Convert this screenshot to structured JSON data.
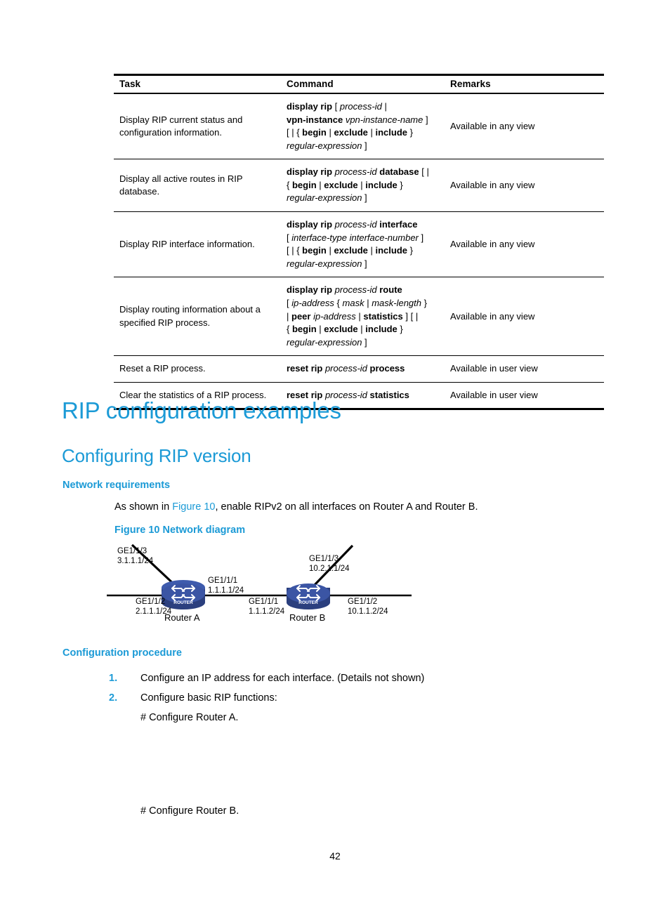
{
  "table": {
    "headers": [
      "Task",
      "Command",
      "Remarks"
    ],
    "rows": [
      {
        "task": "Display RIP current status and configuration information.",
        "command_lines": [
          [
            {
              "t": "display rip",
              "s": "kw"
            },
            {
              "t": " [ ",
              "s": "pn"
            },
            {
              "t": "process-id",
              "s": "var"
            },
            {
              "t": " |",
              "s": "pn"
            }
          ],
          [
            {
              "t": "vpn-instance",
              "s": "kw"
            },
            {
              "t": " ",
              "s": "pn"
            },
            {
              "t": "vpn-instance-name",
              "s": "var"
            },
            {
              "t": " ]",
              "s": "pn"
            }
          ],
          [
            {
              "t": "[ | { ",
              "s": "pn"
            },
            {
              "t": "begin",
              "s": "kw"
            },
            {
              "t": " | ",
              "s": "pn"
            },
            {
              "t": "exclude",
              "s": "kw"
            },
            {
              "t": " | ",
              "s": "pn"
            },
            {
              "t": "include",
              "s": "kw"
            },
            {
              "t": " }",
              "s": "pn"
            }
          ],
          [
            {
              "t": "regular-expression",
              "s": "var"
            },
            {
              "t": " ]",
              "s": "pn"
            }
          ]
        ],
        "remarks": "Available in any view"
      },
      {
        "task": "Display all active routes in RIP database.",
        "command_lines": [
          [
            {
              "t": "display rip",
              "s": "kw"
            },
            {
              "t": " ",
              "s": "pn"
            },
            {
              "t": "process-id",
              "s": "var"
            },
            {
              "t": " ",
              "s": "pn"
            },
            {
              "t": "database",
              "s": "kw"
            },
            {
              "t": " [ |",
              "s": "pn"
            }
          ],
          [
            {
              "t": "{ ",
              "s": "pn"
            },
            {
              "t": "begin",
              "s": "kw"
            },
            {
              "t": " | ",
              "s": "pn"
            },
            {
              "t": "exclude",
              "s": "kw"
            },
            {
              "t": " | ",
              "s": "pn"
            },
            {
              "t": "include",
              "s": "kw"
            },
            {
              "t": " }",
              "s": "pn"
            }
          ],
          [
            {
              "t": "regular-expression",
              "s": "var"
            },
            {
              "t": " ]",
              "s": "pn"
            }
          ]
        ],
        "remarks": "Available in any view"
      },
      {
        "task": "Display RIP interface information.",
        "command_lines": [
          [
            {
              "t": "display rip",
              "s": "kw"
            },
            {
              "t": " ",
              "s": "pn"
            },
            {
              "t": "process-id",
              "s": "var"
            },
            {
              "t": " ",
              "s": "pn"
            },
            {
              "t": "interface",
              "s": "kw"
            }
          ],
          [
            {
              "t": "[ ",
              "s": "pn"
            },
            {
              "t": "interface-type interface-number",
              "s": "var"
            },
            {
              "t": " ]",
              "s": "pn"
            }
          ],
          [
            {
              "t": "[ | { ",
              "s": "pn"
            },
            {
              "t": "begin",
              "s": "kw"
            },
            {
              "t": " | ",
              "s": "pn"
            },
            {
              "t": "exclude",
              "s": "kw"
            },
            {
              "t": " | ",
              "s": "pn"
            },
            {
              "t": "include",
              "s": "kw"
            },
            {
              "t": " }",
              "s": "pn"
            }
          ],
          [
            {
              "t": "regular-expression",
              "s": "var"
            },
            {
              "t": " ]",
              "s": "pn"
            }
          ]
        ],
        "remarks": "Available in any view"
      },
      {
        "task": "Display routing information about a specified RIP process.",
        "command_lines": [
          [
            {
              "t": "display rip",
              "s": "kw"
            },
            {
              "t": " ",
              "s": "pn"
            },
            {
              "t": "process-id",
              "s": "var"
            },
            {
              "t": " ",
              "s": "pn"
            },
            {
              "t": "route",
              "s": "kw"
            }
          ],
          [
            {
              "t": "[ ",
              "s": "pn"
            },
            {
              "t": "ip-address",
              "s": "var"
            },
            {
              "t": " { ",
              "s": "pn"
            },
            {
              "t": "mask",
              "s": "var"
            },
            {
              "t": " | ",
              "s": "pn"
            },
            {
              "t": "mask-length",
              "s": "var"
            },
            {
              "t": " }",
              "s": "pn"
            }
          ],
          [
            {
              "t": "| ",
              "s": "pn"
            },
            {
              "t": "peer",
              "s": "kw"
            },
            {
              "t": " ",
              "s": "pn"
            },
            {
              "t": "ip-address",
              "s": "var"
            },
            {
              "t": " | ",
              "s": "pn"
            },
            {
              "t": "statistics",
              "s": "kw"
            },
            {
              "t": " ] [ |",
              "s": "pn"
            }
          ],
          [
            {
              "t": "{ ",
              "s": "pn"
            },
            {
              "t": "begin",
              "s": "kw"
            },
            {
              "t": " | ",
              "s": "pn"
            },
            {
              "t": "exclude",
              "s": "kw"
            },
            {
              "t": " | ",
              "s": "pn"
            },
            {
              "t": "include",
              "s": "kw"
            },
            {
              "t": " }",
              "s": "pn"
            }
          ],
          [
            {
              "t": "regular-expression",
              "s": "var"
            },
            {
              "t": " ]",
              "s": "pn"
            }
          ]
        ],
        "remarks": "Available in any view"
      },
      {
        "task": "Reset a RIP process.",
        "command_lines": [
          [
            {
              "t": "reset rip",
              "s": "kw"
            },
            {
              "t": " ",
              "s": "pn"
            },
            {
              "t": "process-id",
              "s": "var"
            },
            {
              "t": " ",
              "s": "pn"
            },
            {
              "t": "process",
              "s": "kw"
            }
          ]
        ],
        "remarks": "Available in user view"
      },
      {
        "task": "Clear the statistics of a RIP process.",
        "command_lines": [
          [
            {
              "t": "reset rip",
              "s": "kw"
            },
            {
              "t": " ",
              "s": "pn"
            },
            {
              "t": "process-id",
              "s": "var"
            },
            {
              "t": " ",
              "s": "pn"
            },
            {
              "t": "statistics",
              "s": "kw"
            }
          ]
        ],
        "remarks": "Available in user view"
      }
    ]
  },
  "headings": {
    "h1": "RIP configuration examples",
    "h2": "Configuring RIP version",
    "network_requirements": "Network requirements",
    "configuration_procedure": "Configuration procedure"
  },
  "intro": {
    "prefix": "As shown in ",
    "xref": "Figure 10",
    "suffix": ", enable RIPv2 on all interfaces on Router A and Router B."
  },
  "figure": {
    "caption": "Figure 10 Network diagram",
    "router_a": {
      "name": "Router A",
      "icon_label": "ROUTER",
      "uplink": {
        "iface": "GE1/1/3",
        "ip": "3.1.1.1/24"
      },
      "left": {
        "iface": "GE1/1/2",
        "ip": "2.1.1.1/24"
      },
      "right": {
        "iface": "GE1/1/1",
        "ip": "1.1.1.1/24"
      }
    },
    "router_b": {
      "name": "Router B",
      "icon_label": "ROUTER",
      "uplink": {
        "iface": "GE1/1/3",
        "ip": "10.2.1.1/24"
      },
      "left": {
        "iface": "GE1/1/1",
        "ip": "1.1.1.2/24"
      },
      "right": {
        "iface": "GE1/1/2",
        "ip": "10.1.1.2/24"
      }
    },
    "colors": {
      "router_fill": "#3b55a4",
      "router_top": "#4a6ab8",
      "link": "#000000"
    }
  },
  "procedure": {
    "items": [
      {
        "num": "1.",
        "text": "Configure an IP address for each interface. (Details not shown)"
      },
      {
        "num": "2.",
        "text": "Configure basic RIP functions:"
      }
    ],
    "sub_a": "# Configure Router A.",
    "sub_b": "# Configure Router B."
  },
  "page_number": "42",
  "colors": {
    "accent": "#1b9ad6",
    "text": "#000000",
    "rule": "#000000"
  }
}
